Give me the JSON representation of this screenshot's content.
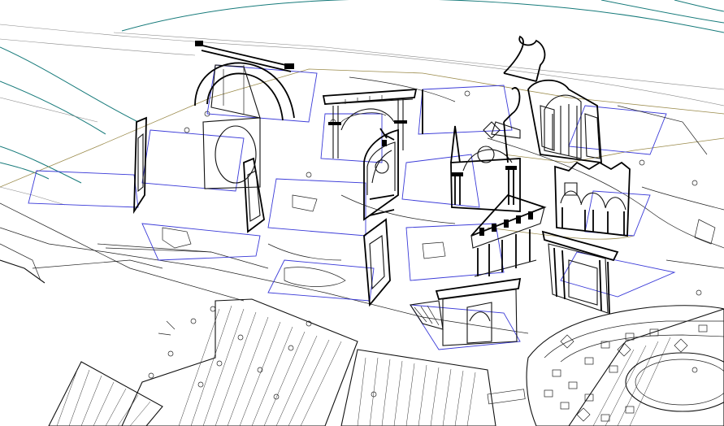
{
  "view": {
    "background": "#ffffff",
    "line_color": "#111111",
    "plan_outline_color": "#3a3ad8",
    "terrain_contour_color": "#167a7a",
    "road_color": "#9a8a4a"
  },
  "icons": {
    "triumphal_arch": "arched-gateway",
    "colonnade_wall": "columned-wall",
    "gothic_window": "gothic-tracery",
    "baroque_gate": "scrolled-pediment",
    "temple_front": "pedimented-portico",
    "crenellated_wall": "crenellated-arcade",
    "square_pavement": "patterned-paving"
  }
}
